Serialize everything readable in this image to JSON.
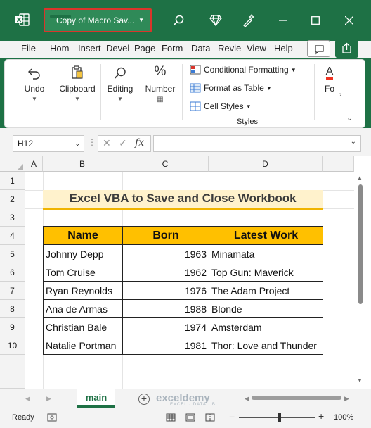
{
  "window": {
    "title": "Copy of Macro Sav..."
  },
  "menu": {
    "tabs": [
      "File",
      "Hom",
      "Insert",
      "Devel",
      "Page",
      "Form",
      "Data",
      "Revie",
      "View",
      "Help"
    ],
    "active": "Hom"
  },
  "ribbon": {
    "undo_label": "Undo",
    "clipboard_label": "Clipboard",
    "editing_label": "Editing",
    "number_label": "Number",
    "conditional_formatting": "Conditional Formatting",
    "format_as_table": "Format as Table",
    "cell_styles": "Cell Styles",
    "styles_group": "Styles",
    "font_label": "Fo"
  },
  "formula_bar": {
    "name_box": "H12",
    "fx_label": "fx",
    "formula": ""
  },
  "grid": {
    "columns": [
      "A",
      "B",
      "C",
      "D"
    ],
    "rows": [
      "1",
      "2",
      "3",
      "4",
      "5",
      "6",
      "7",
      "8",
      "9",
      "10"
    ]
  },
  "sheet": {
    "title": "Excel VBA to Save and Close Workbook",
    "headers": [
      "Name",
      "Born",
      "Latest Work"
    ],
    "rows": [
      {
        "name": "Johnny Depp",
        "born": "1963",
        "work": "Minamata"
      },
      {
        "name": "Tom Cruise",
        "born": "1962",
        "work": "Top Gun: Maverick"
      },
      {
        "name": "Ryan Reynolds",
        "born": "1976",
        "work": "The Adam Project"
      },
      {
        "name": "Ana de Armas",
        "born": "1988",
        "work": "Blonde"
      },
      {
        "name": "Christian Bale",
        "born": "1974",
        "work": "Amsterdam"
      },
      {
        "name": "Natalie Portman",
        "born": "1981",
        "work": "Thor: Love and Thunder"
      }
    ]
  },
  "tabs": {
    "sheet_name": "main",
    "watermark": "exceldemy",
    "watermark_sub": "EXCEL · DATA · BI"
  },
  "status": {
    "ready": "Ready",
    "zoom": "100%",
    "zoom_level_percent": 100
  },
  "colors": {
    "brand_green": "#1e7145",
    "header_fill": "#ffc000",
    "title_fill": "#fff2cc",
    "title_underline": "#f0b400",
    "highlight_border": "#d9352b"
  }
}
